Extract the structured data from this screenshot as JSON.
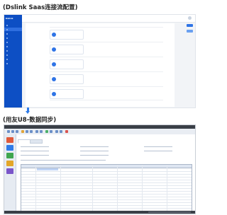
{
  "captions": {
    "top": "(Dslink Saas连接流配置)",
    "bottom": "(用友U8-数据同步)"
  },
  "dslink": {
    "logo": "Dslink",
    "nav": [
      "",
      "",
      "",
      "",
      "",
      "",
      "",
      "",
      "",
      ""
    ],
    "accent": "#0d4fc4"
  },
  "u8": {
    "title": "",
    "form_title": "",
    "accent": "#3a3f47"
  },
  "arrow": {
    "icon": "arrow-down-icon",
    "color": "#2f7be8"
  }
}
